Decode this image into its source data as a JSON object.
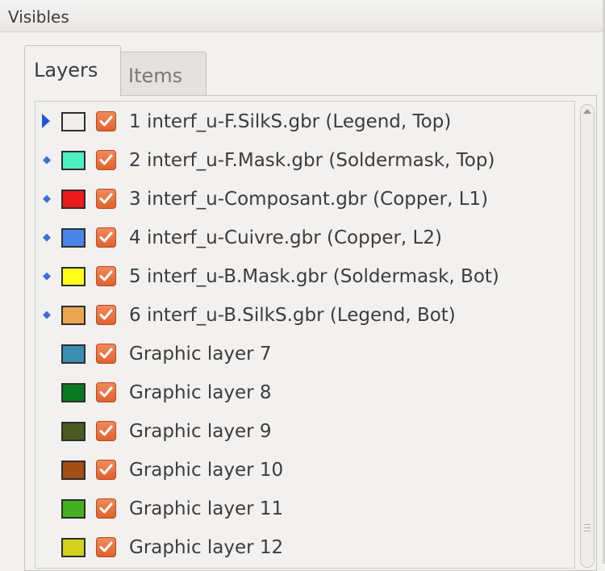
{
  "window": {
    "title": "Visibles"
  },
  "tabs": [
    {
      "label": "Layers",
      "active": true
    },
    {
      "label": "Items",
      "active": false
    }
  ],
  "layers": [
    {
      "label": "1 interf_u-F.SilkS.gbr (Legend, Top)",
      "color": "#f0efec",
      "marker": "active",
      "visible": true
    },
    {
      "label": "2 interf_u-F.Mask.gbr (Soldermask, Top)",
      "color": "#4ff0c0",
      "marker": "diamond",
      "visible": true
    },
    {
      "label": "3 interf_u-Composant.gbr (Copper, L1)",
      "color": "#ee1a1a",
      "marker": "diamond",
      "visible": true
    },
    {
      "label": "4 interf_u-Cuivre.gbr (Copper, L2)",
      "color": "#4a86e8",
      "marker": "diamond",
      "visible": true
    },
    {
      "label": "5 interf_u-B.Mask.gbr (Soldermask, Bot)",
      "color": "#ffff1a",
      "marker": "diamond",
      "visible": true
    },
    {
      "label": "6 interf_u-B.SilkS.gbr (Legend, Bot)",
      "color": "#eba550",
      "marker": "diamond",
      "visible": true
    },
    {
      "label": "Graphic layer 7",
      "color": "#3a8fb0",
      "marker": "none",
      "visible": true
    },
    {
      "label": "Graphic layer 8",
      "color": "#0a7a20",
      "marker": "none",
      "visible": true
    },
    {
      "label": "Graphic layer 9",
      "color": "#4a5a20",
      "marker": "none",
      "visible": true
    },
    {
      "label": "Graphic layer 10",
      "color": "#a24e14",
      "marker": "none",
      "visible": true
    },
    {
      "label": "Graphic layer 11",
      "color": "#44b020",
      "marker": "none",
      "visible": true
    },
    {
      "label": "Graphic layer 12",
      "color": "#d2d21c",
      "marker": "none",
      "visible": true
    }
  ],
  "icons": {
    "active_marker": "triangle-right-icon",
    "row_marker": "diamond-icon",
    "visibility": "checkbox-checked-icon"
  }
}
